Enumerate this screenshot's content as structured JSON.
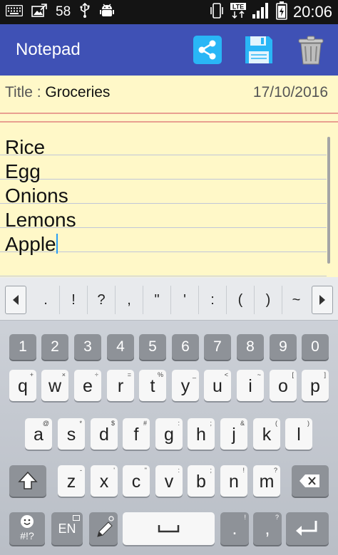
{
  "status_bar": {
    "notification_count": "58",
    "time": "20:06",
    "network": "LTE"
  },
  "app_bar": {
    "title": "Notepad",
    "actions": [
      {
        "name": "share-icon",
        "color": "#29b6f6"
      },
      {
        "name": "save-icon",
        "color": "#29b6f6"
      },
      {
        "name": "trash-icon",
        "color": "#9e9e9e"
      }
    ]
  },
  "note": {
    "title_label": "Title : ",
    "title_value": "Groceries",
    "date": "17/10/2016",
    "lines": [
      "Rice",
      "Egg",
      "Onions",
      "Lemons",
      "Apple"
    ]
  },
  "keyboard": {
    "symbols": [
      ".",
      "!",
      "?",
      ",",
      "\"",
      "'",
      ":",
      "(",
      ")",
      "~"
    ],
    "numbers": [
      "1",
      "2",
      "3",
      "4",
      "5",
      "6",
      "7",
      "8",
      "9",
      "0"
    ],
    "row1": [
      {
        "l": "q",
        "s": "+"
      },
      {
        "l": "w",
        "s": "×"
      },
      {
        "l": "e",
        "s": "÷"
      },
      {
        "l": "r",
        "s": "="
      },
      {
        "l": "t",
        "s": "%"
      },
      {
        "l": "y",
        "s": "_"
      },
      {
        "l": "u",
        "s": "<"
      },
      {
        "l": "i",
        "s": "~"
      },
      {
        "l": "o",
        "s": "["
      },
      {
        "l": "p",
        "s": "]"
      }
    ],
    "row2": [
      {
        "l": "a",
        "s": "@"
      },
      {
        "l": "s",
        "s": "*"
      },
      {
        "l": "d",
        "s": "$"
      },
      {
        "l": "f",
        "s": "#"
      },
      {
        "l": "g",
        "s": ":"
      },
      {
        "l": "h",
        "s": ";"
      },
      {
        "l": "j",
        "s": "&"
      },
      {
        "l": "k",
        "s": "("
      },
      {
        "l": "l",
        "s": ")"
      }
    ],
    "row3": [
      {
        "l": "z",
        "s": "-"
      },
      {
        "l": "x",
        "s": "'"
      },
      {
        "l": "c",
        "s": "\""
      },
      {
        "l": "v",
        "s": ":"
      },
      {
        "l": "b",
        "s": ";"
      },
      {
        "l": "n",
        "s": "!"
      },
      {
        "l": "m",
        "s": "?"
      }
    ],
    "emoji_label": "#!?",
    "lang_label": "EN",
    "punct_keys": [
      {
        "l": ".",
        "s": "!"
      },
      {
        "l": ",",
        "s": "?"
      }
    ]
  }
}
